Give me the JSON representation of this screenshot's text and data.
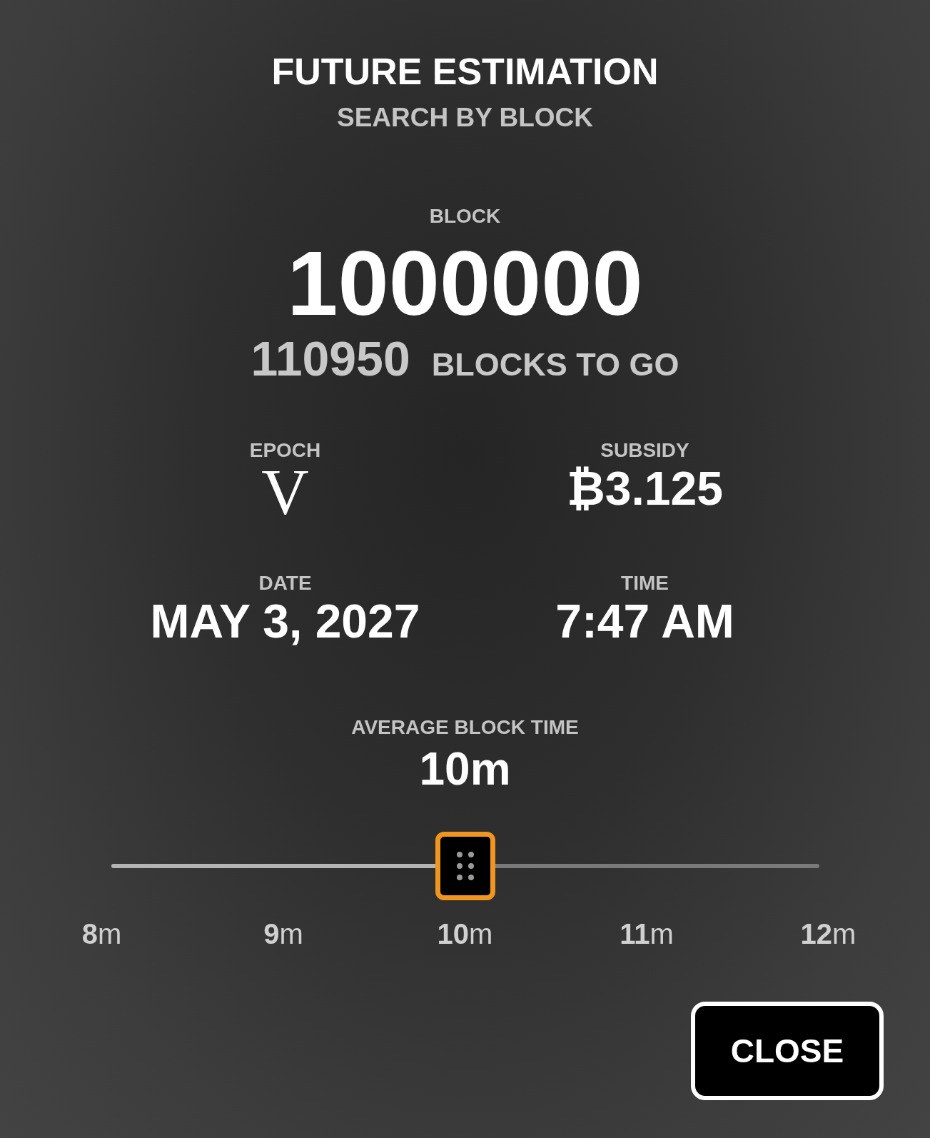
{
  "title": "FUTURE ESTIMATION",
  "subtitle": "SEARCH BY BLOCK",
  "block": {
    "label": "BLOCK",
    "value": "1000000",
    "remaining": "110950",
    "remaining_label": "BLOCKS TO GO"
  },
  "stats": [
    {
      "label": "EPOCH",
      "value": "V",
      "kind": "roman"
    },
    {
      "label": "SUBSIDY",
      "value": "₿3.125",
      "kind": "plain"
    },
    {
      "label": "DATE",
      "value": "MAY 3, 2027",
      "kind": "plain"
    },
    {
      "label": "TIME",
      "value": "7:47 AM",
      "kind": "plain"
    }
  ],
  "average_block_time": {
    "label": "AVERAGE BLOCK TIME",
    "value": "10m",
    "level": 0.5,
    "ticks": [
      "**8**m",
      "**9**m",
      "**10**m",
      "**11**m",
      "**12**m"
    ]
  },
  "buttons": [
    {
      "label": "CLOSE"
    }
  ]
}
